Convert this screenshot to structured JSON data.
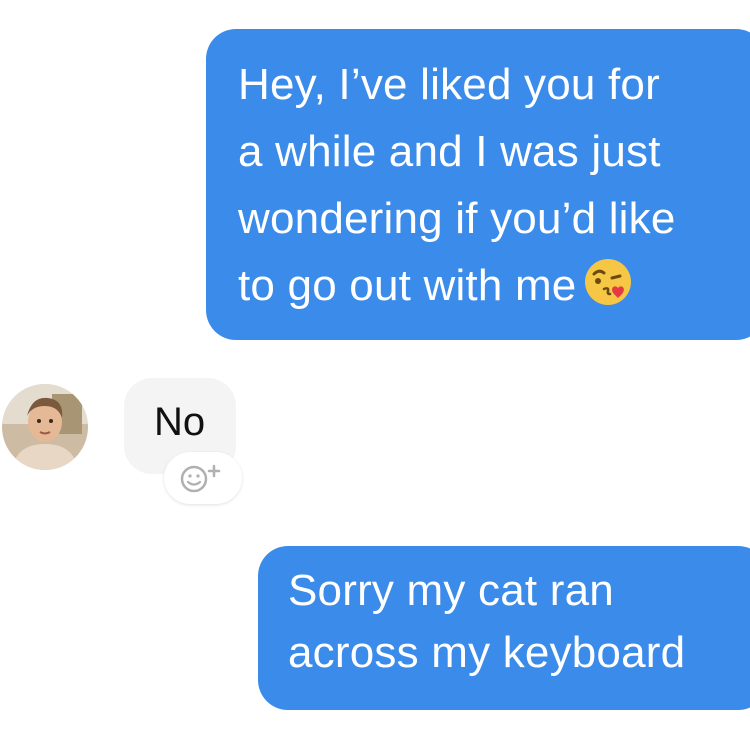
{
  "thread": {
    "outgoing_1": {
      "lines": [
        "Hey, I’ve liked you for",
        "a while and I was just",
        "wondering if you’d like",
        "to go out with me"
      ],
      "emoji_icon": "face-blowing-kiss-icon"
    },
    "incoming_1": {
      "text": "No",
      "avatar_icon": "contact-avatar-photo"
    },
    "reaction_button_icon": "add-reaction-icon",
    "outgoing_2": {
      "lines": [
        "Sorry my cat ran",
        "across my keyboard"
      ]
    }
  },
  "colors": {
    "outgoing_bubble": "#3b8bea",
    "incoming_bubble": "#f4f4f4",
    "outgoing_text": "#ffffff",
    "incoming_text": "#111111"
  }
}
